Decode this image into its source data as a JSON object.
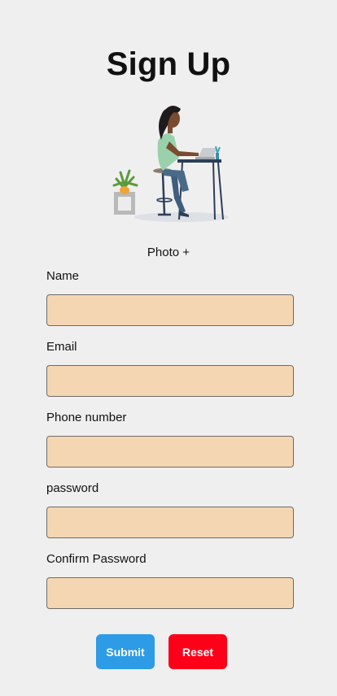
{
  "page": {
    "title": "Sign Up",
    "photo_label": "Photo +"
  },
  "form": {
    "fields": [
      {
        "label": "Name",
        "value": "",
        "type": "text"
      },
      {
        "label": "Email",
        "value": "",
        "type": "email"
      },
      {
        "label": "Phone number",
        "value": "",
        "type": "tel"
      },
      {
        "label": "password",
        "value": "",
        "type": "password"
      },
      {
        "label": "Confirm Password",
        "value": "",
        "type": "password"
      }
    ],
    "submit_label": "Submit",
    "reset_label": "Reset"
  },
  "colors": {
    "background": "#f0eff0",
    "input_fill": "#f5d6b3",
    "submit": "#2d9be6",
    "reset": "#fd0119"
  },
  "icons": {
    "illustration": "woman-at-desk-illustration"
  }
}
